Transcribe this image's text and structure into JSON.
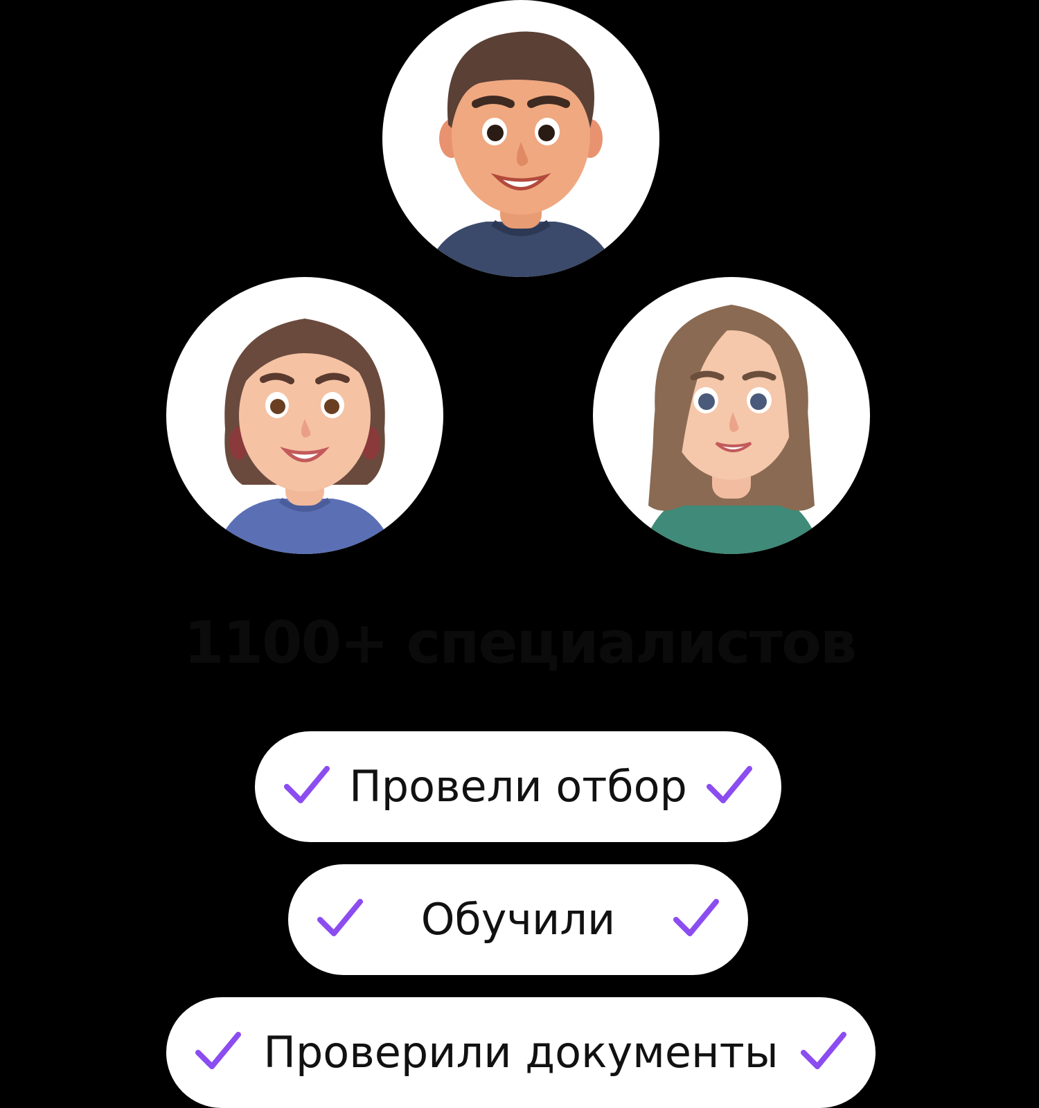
{
  "headline": "1100+ специалистов",
  "avatars": [
    {
      "icon": "avatar-man-icon",
      "shirt_color": "#3b4a6b",
      "hair_color": "#5a4035"
    },
    {
      "icon": "avatar-woman-short-hair-icon",
      "shirt_color": "#5b6fb5",
      "hair_color": "#6b4a3e"
    },
    {
      "icon": "avatar-woman-long-hair-icon",
      "shirt_color": "#3f8a78",
      "hair_color": "#8a6a52"
    }
  ],
  "pills": [
    {
      "label": "Провели отбор"
    },
    {
      "label": "Обучили"
    },
    {
      "label": "Проверили документы"
    }
  ],
  "colors": {
    "background": "#000000",
    "card": "#ffffff",
    "check": "#8b4cf0",
    "text": "#111111"
  },
  "icons": {
    "check": "check-icon"
  }
}
